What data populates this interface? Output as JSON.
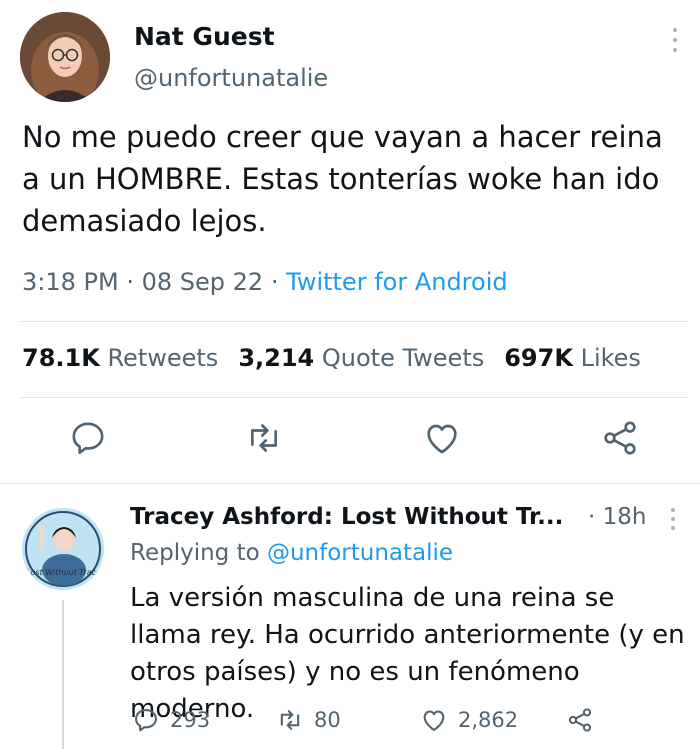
{
  "tweet": {
    "author_name": "Nat Guest",
    "handle": "@unfortunatalie",
    "text": "No me puedo creer que vayan a hacer reina a un HOMBRE. Estas tonterías woke han ido demasiado lejos.",
    "time": "3:18 PM",
    "date": "08 Sep 22",
    "separator": "·",
    "source": "Twitter for Android",
    "stats": {
      "retweets_count": "78.1K",
      "retweets_label": "Retweets",
      "quotes_count": "3,214",
      "quotes_label": "Quote Tweets",
      "likes_count": "697K",
      "likes_label": "Likes"
    },
    "actions": [
      "reply-icon",
      "retweet-icon",
      "like-icon",
      "share-icon"
    ]
  },
  "reply": {
    "author_name": "Tracey Ashford: Lost Without Tr...",
    "time": "· 18h",
    "replying_prefix": "Replying to",
    "replying_handle": "@unfortunatalie",
    "avatar_text": "Lost Without Trace",
    "text": "La versión masculina de una reina se llama rey. Ha ocurrido anteriormente (y en otros países) y no es un fenómeno moderno.",
    "counts": {
      "replies": "293",
      "retweets": "80",
      "likes": "2,862"
    }
  },
  "colors": {
    "text": "#0f1419",
    "secondary": "#536471",
    "link": "#1d9bf0",
    "divider": "#dfe4e8"
  }
}
